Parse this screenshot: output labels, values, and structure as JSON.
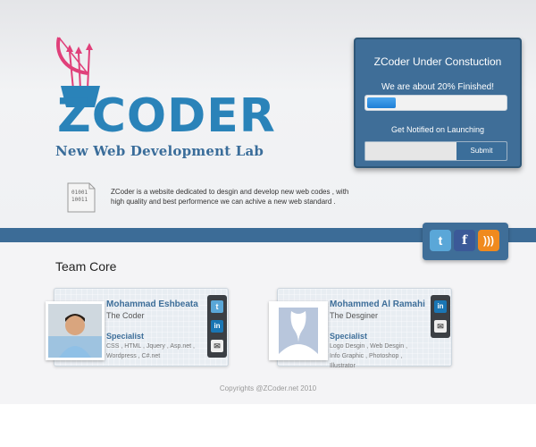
{
  "brand": {
    "logo_text": "ZCODER",
    "tagline": "New Web Development Lab"
  },
  "status": {
    "title": "ZCoder Under Constuction",
    "progress_label": "We are about 20% Finished!",
    "progress_percent": 20,
    "notify_label": "Get Notified on Launching",
    "email_value": "",
    "submit_label": "Submit"
  },
  "intro": {
    "icon": "binary-document-icon",
    "binary_text": "01001\n10011",
    "text": "ZCoder is a website dedicated to desgin and develop new web codes , with high quality and best performence we can achive a new web standard ."
  },
  "social": {
    "twitter_glyph": "t",
    "facebook_glyph": "f",
    "rss_glyph": ")))"
  },
  "team": {
    "heading": "Team Core",
    "members": [
      {
        "name": "Mohammad Eshbeata",
        "role": "The Coder",
        "specialist_label": "Specialist",
        "skills": "CSS , HTML , Jquery , Asp.net , Wordpress , C#.net",
        "icons": [
          "twitter-icon",
          "linkedin-icon",
          "mail-icon"
        ]
      },
      {
        "name": "Mohammed Al Ramahi",
        "role": "The Desginer",
        "specialist_label": "Specialist",
        "skills": "Logo Desgin , Web Desgin , Info Graphic , Photoshop , Illustrator",
        "icons": [
          "linkedin-icon",
          "mail-icon"
        ]
      }
    ]
  },
  "footer": {
    "copyright": "Copyrights @ZCoder.net 2010"
  },
  "colors": {
    "primary": "#3f6e98",
    "logo_blue": "#2a83b9",
    "logo_pink": "#e0407a",
    "progress": "#1f7fd6"
  }
}
